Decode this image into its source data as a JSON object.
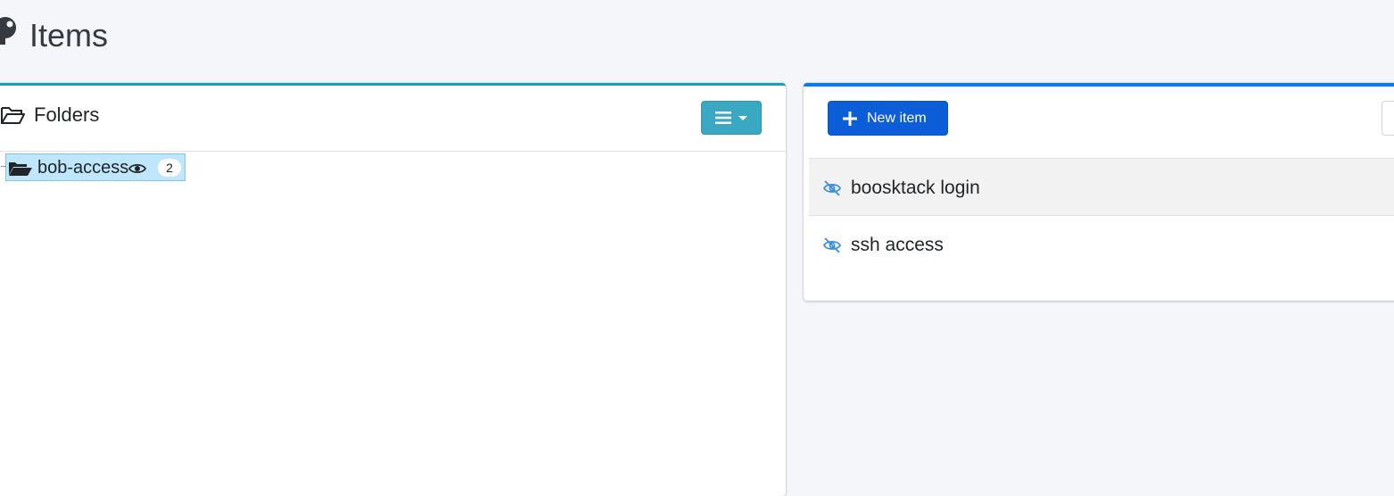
{
  "page": {
    "title": "Items",
    "icon": "key-icon"
  },
  "folders": {
    "title": "Folders",
    "header_icon": "folder-open-icon",
    "menu_button_icon": "bars-icon",
    "accent_color": "#17a2b8",
    "tree": [
      {
        "label": "bob-access",
        "icon": "folder-open-icon",
        "visibility_icon": "eye-icon",
        "count": "2",
        "selected": true
      }
    ]
  },
  "items": {
    "accent_color": "#007bff",
    "new_item_label": "New item",
    "new_item_icon": "plus-icon",
    "rows": [
      {
        "label": "boosktack login",
        "icon": "eye-slash-icon"
      },
      {
        "label": "ssh access",
        "icon": "eye-slash-icon"
      }
    ]
  }
}
